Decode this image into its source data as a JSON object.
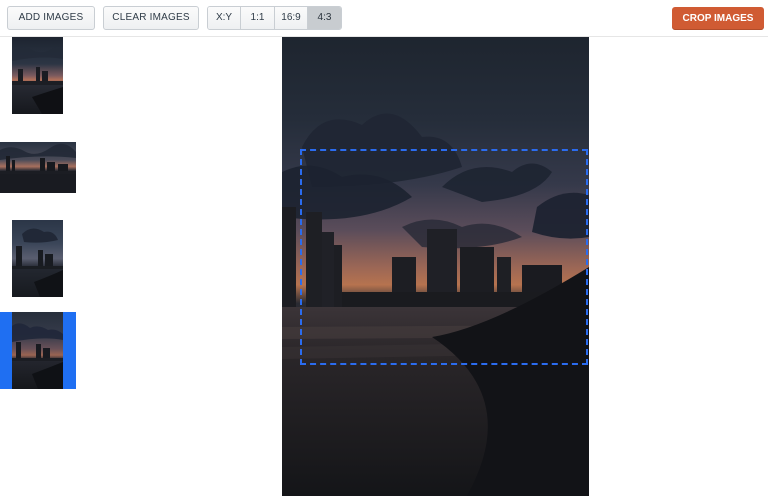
{
  "toolbar": {
    "add_label": "ADD IMAGES",
    "clear_label": "CLEAR IMAGES",
    "ratios": [
      {
        "label": "X:Y",
        "active": false
      },
      {
        "label": "1:1",
        "active": false
      },
      {
        "label": "16:9",
        "active": false
      },
      {
        "label": "4:3",
        "active": true
      }
    ],
    "crop_label": "CROP IMAGES"
  },
  "thumbnails": {
    "count": 4,
    "selected_index": 3
  },
  "crop": {
    "aspect_ratio": "4:3"
  },
  "colors": {
    "accent": "#d05b33",
    "selection": "#1f6ff2",
    "crop_border": "#2b6cf0"
  }
}
